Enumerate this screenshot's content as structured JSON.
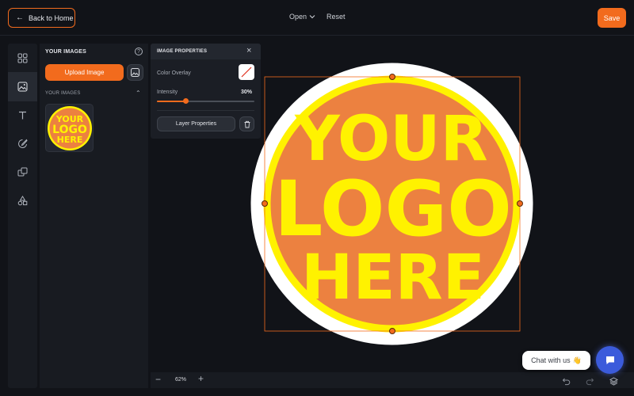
{
  "topbar": {
    "back_label": "Back to Home",
    "open_label": "Open",
    "reset_label": "Reset",
    "save_label": "Save",
    "accent": "#f26b1d"
  },
  "rail": {
    "items": [
      {
        "icon": "grid-icon"
      },
      {
        "icon": "image-icon",
        "active": true
      },
      {
        "icon": "text-icon"
      },
      {
        "icon": "brush-icon"
      },
      {
        "icon": "chat-edit-icon"
      },
      {
        "icon": "shapes-icon"
      }
    ]
  },
  "images_panel": {
    "title": "YOUR IMAGES",
    "upload_label": "Upload Image",
    "section_label": "YOUR IMAGES",
    "thumb_text": [
      "YOUR",
      "LOGO",
      "HERE"
    ]
  },
  "props_panel": {
    "title": "IMAGE PROPERTIES",
    "overlay_label": "Color Overlay",
    "intensity_label": "Intensity",
    "intensity_value": "30%",
    "intensity_fraction": 0.3,
    "layer_label": "Layer Properties"
  },
  "canvas": {
    "logo_line1": "YOUR",
    "logo_line2": "LOGO",
    "logo_line3": "HERE",
    "logo_fill": "#ec8140",
    "logo_ring": "#fff200"
  },
  "bottombar": {
    "zoom": "62%"
  },
  "chat": {
    "label": "Chat with us",
    "emoji": "👋"
  }
}
